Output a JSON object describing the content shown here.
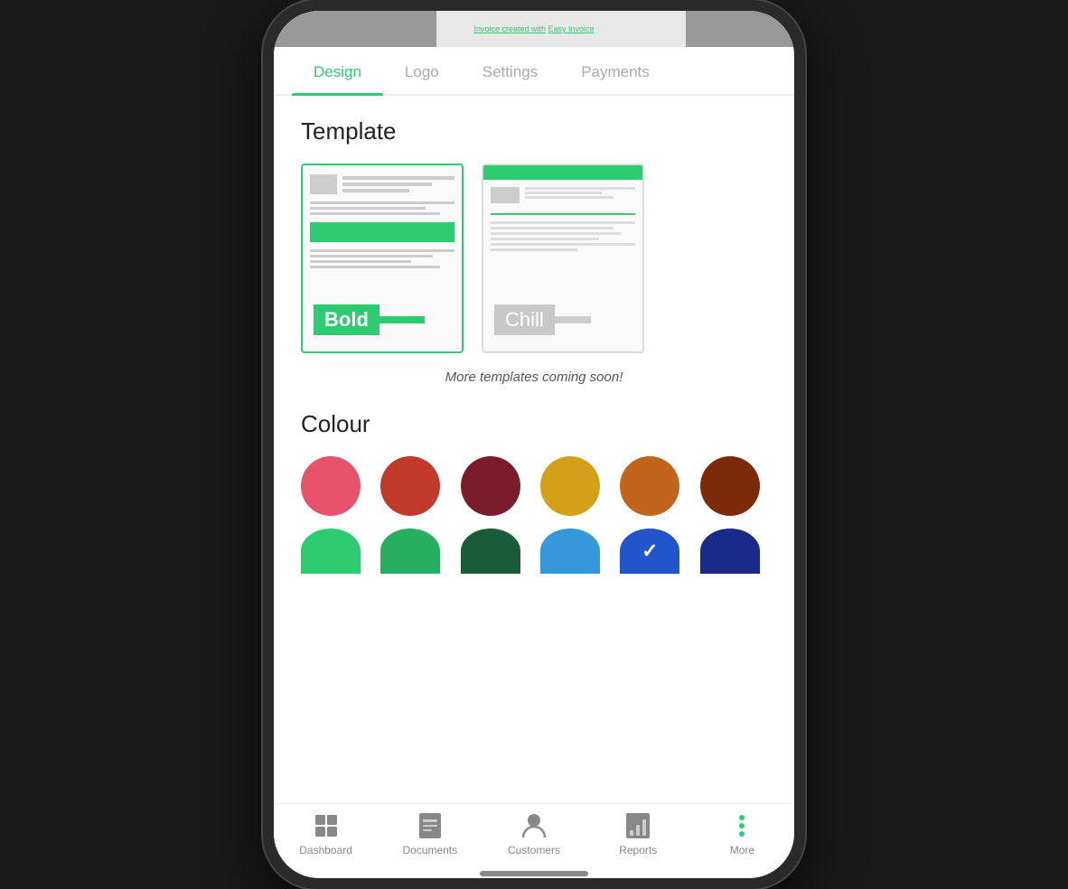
{
  "app": {
    "invoice_text": "Invoice created with",
    "invoice_link": "Easy Invoice"
  },
  "tabs": [
    {
      "id": "design",
      "label": "Design",
      "active": true
    },
    {
      "id": "logo",
      "label": "Logo",
      "active": false
    },
    {
      "id": "settings",
      "label": "Settings",
      "active": false
    },
    {
      "id": "payments",
      "label": "Payments",
      "active": false
    }
  ],
  "template_section": {
    "title": "Template",
    "templates": [
      {
        "id": "bold",
        "label": "Bold",
        "selected": true
      },
      {
        "id": "chill",
        "label": "Chill",
        "selected": false
      }
    ],
    "coming_soon_text": "More templates coming soon!"
  },
  "colour_section": {
    "title": "Colour",
    "colors": [
      {
        "id": "pink-red",
        "hex": "#e8526a",
        "selected": false,
        "row": 1
      },
      {
        "id": "red",
        "hex": "#c0392b",
        "selected": false,
        "row": 1
      },
      {
        "id": "dark-red",
        "hex": "#7b1c2a",
        "selected": false,
        "row": 1
      },
      {
        "id": "yellow",
        "hex": "#d4a017",
        "selected": false,
        "row": 1
      },
      {
        "id": "orange-brown",
        "hex": "#c0651a",
        "selected": false,
        "row": 1
      },
      {
        "id": "brown",
        "hex": "#7d2a0a",
        "selected": false,
        "row": 1
      },
      {
        "id": "light-green",
        "hex": "#2ecc71",
        "selected": false,
        "row": 2,
        "bottomCut": true
      },
      {
        "id": "green",
        "hex": "#27ae60",
        "selected": false,
        "row": 2,
        "bottomCut": true
      },
      {
        "id": "dark-green",
        "hex": "#1a5c3a",
        "selected": false,
        "row": 2,
        "bottomCut": true
      },
      {
        "id": "blue",
        "hex": "#3498db",
        "selected": false,
        "row": 2,
        "bottomCut": true
      },
      {
        "id": "royal-blue",
        "hex": "#2255cc",
        "selected": true,
        "row": 2,
        "bottomCut": true
      },
      {
        "id": "navy",
        "hex": "#1a2a8a",
        "selected": false,
        "row": 2,
        "bottomCut": true
      }
    ]
  },
  "bottom_nav": [
    {
      "id": "dashboard",
      "label": "Dashboard",
      "icon": "dashboard-icon"
    },
    {
      "id": "documents",
      "label": "Documents",
      "icon": "documents-icon"
    },
    {
      "id": "customers",
      "label": "Customers",
      "icon": "customers-icon"
    },
    {
      "id": "reports",
      "label": "Reports",
      "icon": "reports-icon"
    },
    {
      "id": "more",
      "label": "More",
      "icon": "more-icon"
    }
  ]
}
